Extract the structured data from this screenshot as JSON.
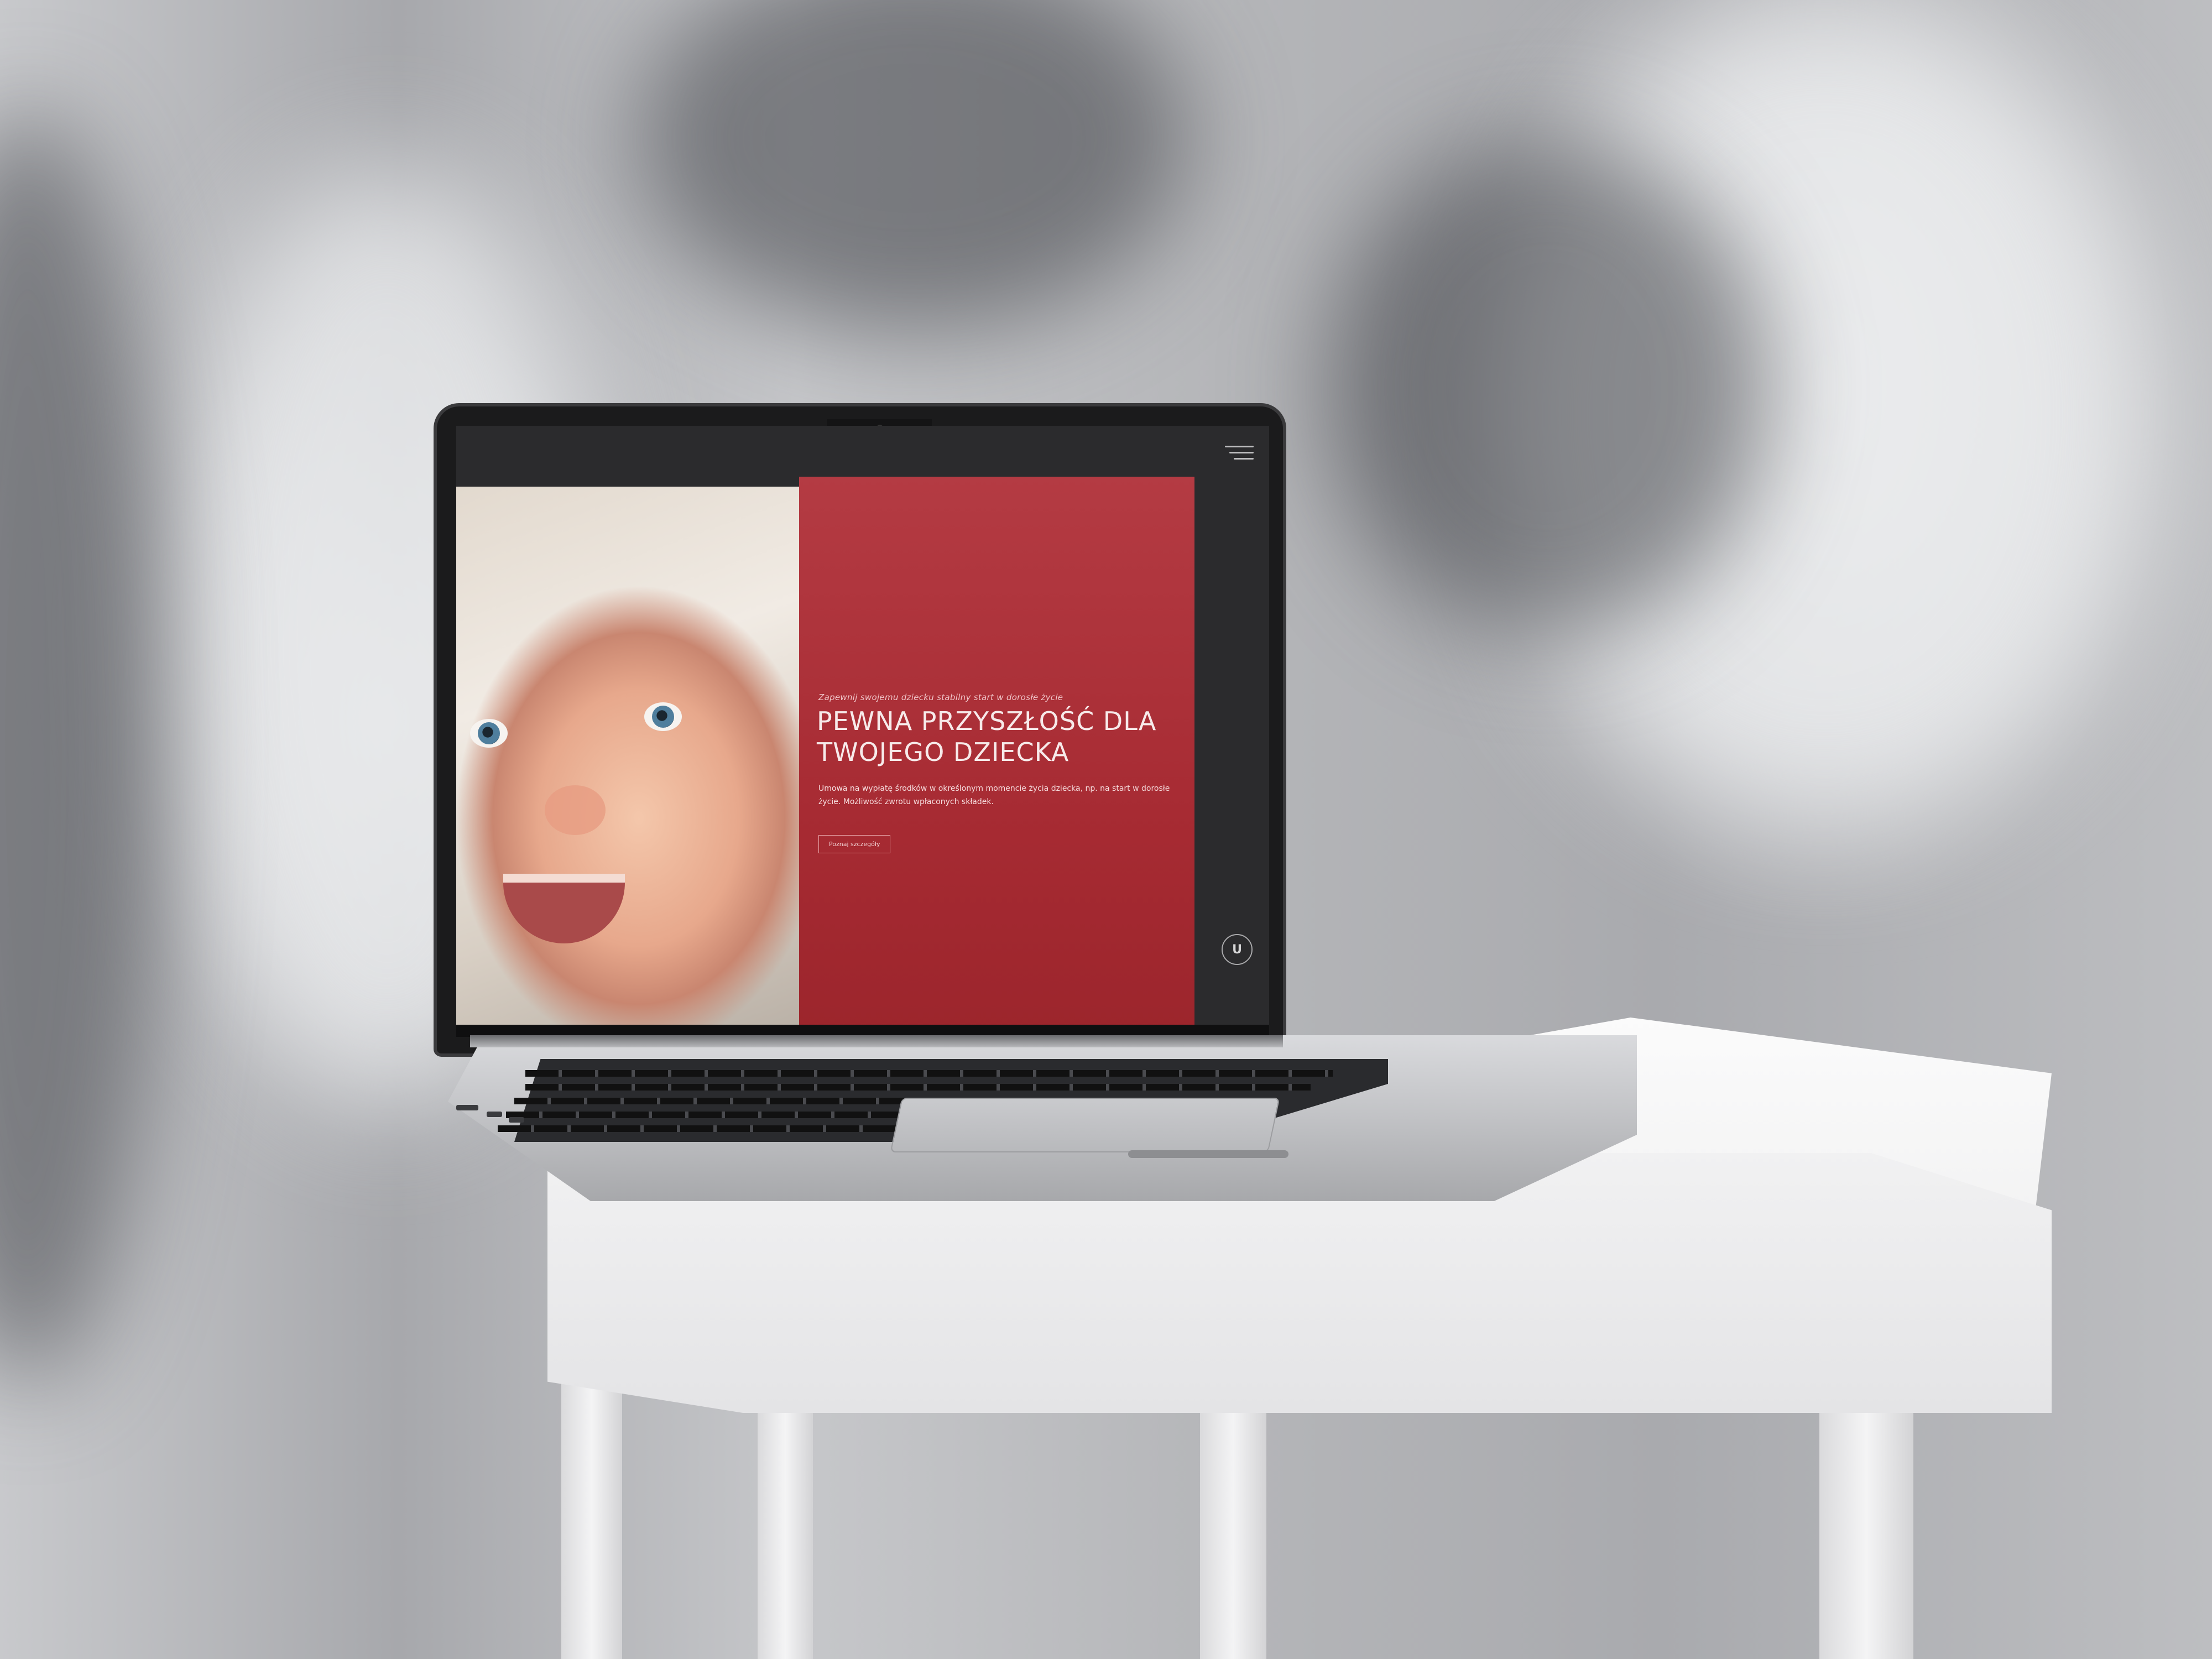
{
  "website": {
    "tagline": "Zapewnij swojemu dziecku stabilny start w dorosłe życie",
    "title": "PEWNA PRZYSZŁOŚĆ DLA TWOJEGO DZIECKA",
    "description": "Umowa na wypłatę środków w określonym momencie życia dziecka, np. na start w dorosłe życie. Możliwość zwrotu wpłaconych składek.",
    "cta_label": "Poznaj szczegóły",
    "logo_letter": "U",
    "menu_icon": "hamburger-menu-icon",
    "colors": {
      "hero_red": "#a72b33",
      "screen_dark": "#2b2b2d",
      "text_light": "#f7eaea"
    }
  }
}
